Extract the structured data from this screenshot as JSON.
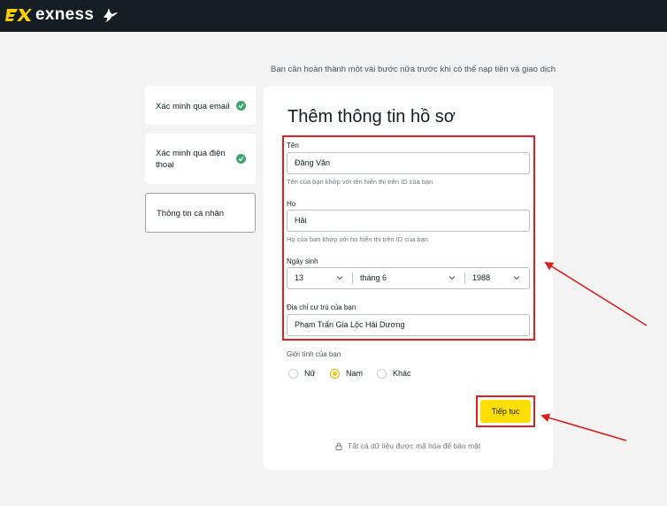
{
  "header": {
    "brand": "exness",
    "logo_icon": "exness-logo-mark",
    "bird_icon": "dove-icon"
  },
  "subtitle": "Bạn cần hoàn thành một vài bước nữa trước khi có thể nạp tiền và giao dịch",
  "steps": [
    {
      "label": "Xác minh qua email",
      "status": "done",
      "icon": "check-circle-icon"
    },
    {
      "label": "Xác minh qua điện thoại",
      "status": "done",
      "icon": "check-circle-icon"
    },
    {
      "label": "Thông tin cá nhân",
      "status": "active"
    }
  ],
  "form": {
    "title": "Thêm thông tin hồ sơ",
    "first_name": {
      "label": "Tên",
      "value": "Đặng Văn",
      "hint": "Tên của bạn khớp với tên hiển thị trên ID của bạn"
    },
    "last_name": {
      "label": "Họ",
      "value": "Hải",
      "hint": "Họ của bạn khớp với họ hiển thị trên ID của bạn"
    },
    "dob": {
      "label": "Ngày sinh",
      "day": "13",
      "month": "tháng 6",
      "year": "1988"
    },
    "address": {
      "label": "Địa chỉ cư trú của bạn",
      "value": "Phạm Trấn Gia Lộc Hải Dương"
    },
    "gender": {
      "label": "Giới tính của bạn",
      "options": [
        "Nữ",
        "Nam",
        "Khác"
      ],
      "selected": "Nam"
    },
    "submit_label": "Tiếp tục",
    "security_note": "Tất cả dữ liệu được mã hóa để bảo mật"
  },
  "colors": {
    "header_bg": "#141d22",
    "accent": "#ffde02",
    "highlight": "#e02020",
    "success": "#3aa76d"
  }
}
